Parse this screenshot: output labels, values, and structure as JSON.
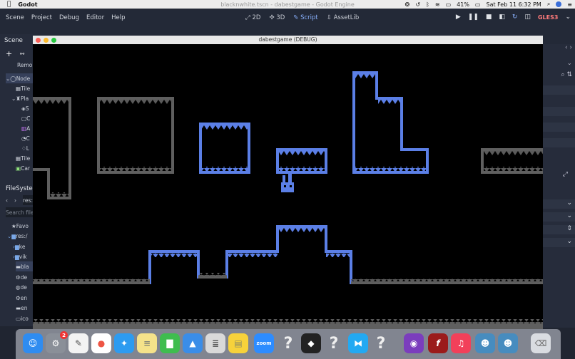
{
  "menubar": {
    "app_name": "Godot",
    "window_title": "blacknwhite.tscn - dabestgame - Godot Engine",
    "battery": "41%",
    "datetime": "Sat Feb 11  6:32 PM"
  },
  "godot": {
    "menu": [
      "Scene",
      "Project",
      "Debug",
      "Editor",
      "Help"
    ],
    "workspaces": [
      "2D",
      "3D",
      "Script",
      "AssetLib"
    ],
    "renderer": "GLES3"
  },
  "scene_dock": {
    "tab": "Scene",
    "remote_label": "Remo",
    "tree": [
      "Node",
      "Tile",
      "Pla",
      "S",
      "C",
      "A",
      "C",
      "L",
      "Tile",
      "Car"
    ]
  },
  "filesystem_dock": {
    "tab": "FileSystem",
    "path": "res:",
    "search_placeholder": "Search file",
    "items": [
      "Favo",
      "res:/",
      "ke",
      "vik",
      "bla",
      "de",
      "de",
      "en",
      "en",
      "ico"
    ]
  },
  "debug_window": {
    "title": "dabestgame (DEBUG)"
  },
  "dock": {
    "items": [
      {
        "name": "finder",
        "glyph": "☺",
        "color": "#2f8cf0"
      },
      {
        "name": "system-preferences",
        "glyph": "⚙",
        "color": "#8a8f98",
        "badge": "2"
      },
      {
        "name": "textedit",
        "glyph": "✎",
        "color": "#f3f3f3"
      },
      {
        "name": "chrome",
        "glyph": "●",
        "color": "#ffffff"
      },
      {
        "name": "safari",
        "glyph": "✦",
        "color": "#2d9bf0"
      },
      {
        "name": "notes",
        "glyph": "≡",
        "color": "#f5e28a"
      },
      {
        "name": "numbers",
        "glyph": "▇",
        "color": "#3fbd4f"
      },
      {
        "name": "keynote",
        "glyph": "▲",
        "color": "#3a8de8"
      },
      {
        "name": "textfile",
        "glyph": "≣",
        "color": "#d9d9d9"
      },
      {
        "name": "stickies",
        "glyph": "▤",
        "color": "#f7d23b"
      },
      {
        "name": "zoom",
        "glyph": "zoom",
        "color": "#2d8cff"
      },
      {
        "name": "unknown",
        "glyph": "?",
        "color": "transparent"
      },
      {
        "name": "unity",
        "glyph": "◆",
        "color": "#222"
      },
      {
        "name": "unknown",
        "glyph": "?",
        "color": "transparent"
      },
      {
        "name": "vscode",
        "glyph": "⧓",
        "color": "#23a9f2"
      },
      {
        "name": "unknown",
        "glyph": "?",
        "color": "transparent"
      },
      {
        "name": "github",
        "glyph": "◉",
        "color": "#7b3dbd"
      },
      {
        "name": "flash",
        "glyph": "f",
        "color": "#9b1b1b"
      },
      {
        "name": "music",
        "glyph": "♫",
        "color": "#f2405a"
      },
      {
        "name": "godot",
        "glyph": "☻",
        "color": "#478cbf"
      },
      {
        "name": "godot",
        "glyph": "☻",
        "color": "#478cbf"
      },
      {
        "name": "trash",
        "glyph": "🗑",
        "color": "#d9dce1"
      }
    ]
  }
}
